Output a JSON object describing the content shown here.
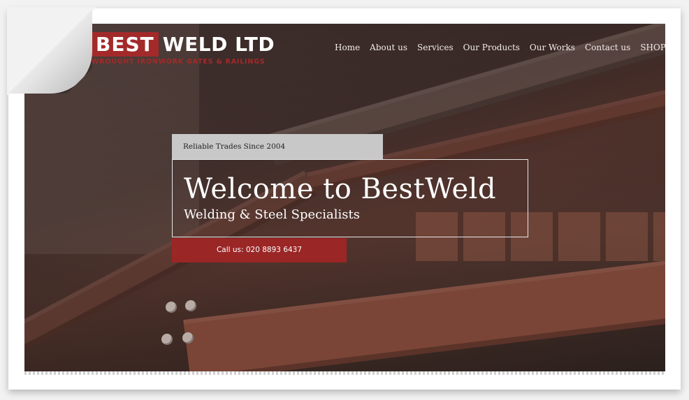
{
  "logo": {
    "best": "BEST",
    "weld": "WELD LTD",
    "tagline": "WROUGHT IRONWORK GATES & RAILINGS"
  },
  "nav": [
    "Home",
    "About us",
    "Services",
    "Our Products",
    "Our Works",
    "Contact us",
    "SHOP"
  ],
  "hero": {
    "tagline": "Reliable Trades Since 2004",
    "title": "Welcome to BestWeld",
    "subtitle": "Welding & Steel Specialists",
    "call_label": "Call us: 020 8893 6437"
  },
  "colors": {
    "brand_red": "#a32a2a",
    "button_red": "#9a2626",
    "tag_box": "#c8c8c8"
  }
}
